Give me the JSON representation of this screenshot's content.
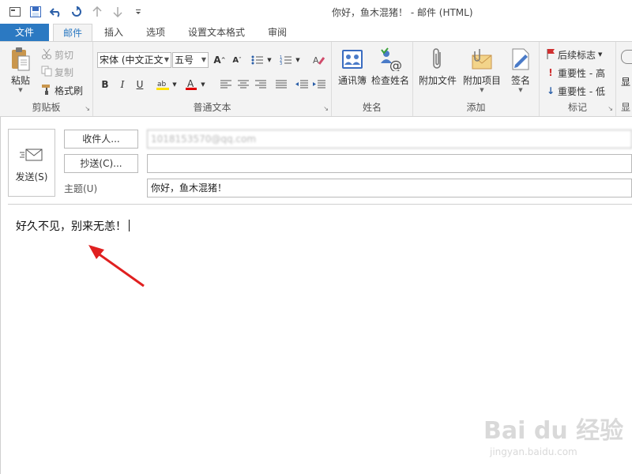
{
  "window": {
    "title": "你好，鱼木混猪！ - 邮件 (HTML)"
  },
  "tabs": [
    {
      "label": "文件"
    },
    {
      "label": "邮件"
    },
    {
      "label": "插入"
    },
    {
      "label": "选项"
    },
    {
      "label": "设置文本格式"
    },
    {
      "label": "审阅"
    }
  ],
  "ribbon": {
    "clipboard": {
      "label": "剪贴板",
      "paste": "粘贴",
      "cut": "剪切",
      "copy": "复制",
      "format_painter": "格式刷"
    },
    "basic_text": {
      "label": "普通文本",
      "font": "宋体 (中文正文",
      "size": "五号"
    },
    "names": {
      "label": "姓名",
      "address_book": "通讯簿",
      "check_names": "检查姓名"
    },
    "include": {
      "label": "添加",
      "attach_file": "附加文件",
      "attach_item": "附加项目",
      "signature": "签名"
    },
    "tags": {
      "label": "标记",
      "follow_up": "后续标志",
      "high_importance": "重要性 - 高",
      "low_importance": "重要性 - 低"
    },
    "partial": {
      "show": "显",
      "show2": "显"
    }
  },
  "compose": {
    "send": "发送(S)",
    "to_button": "收件人...",
    "to_value": "1018153570@qq.com",
    "cc_button": "抄送(C)...",
    "cc_value": "",
    "subject_label": "主题(U)",
    "subject_value": "你好，鱼木混猪！",
    "body": "好久不见，别来无恙！"
  },
  "watermark": {
    "main": "Bai du 经验",
    "sub": "jingyan.baidu.com"
  },
  "colors": {
    "file_tab": "#2b79c2",
    "arrow": "#e02020",
    "highlight": "#ffe100",
    "font_color": "#e00000"
  }
}
